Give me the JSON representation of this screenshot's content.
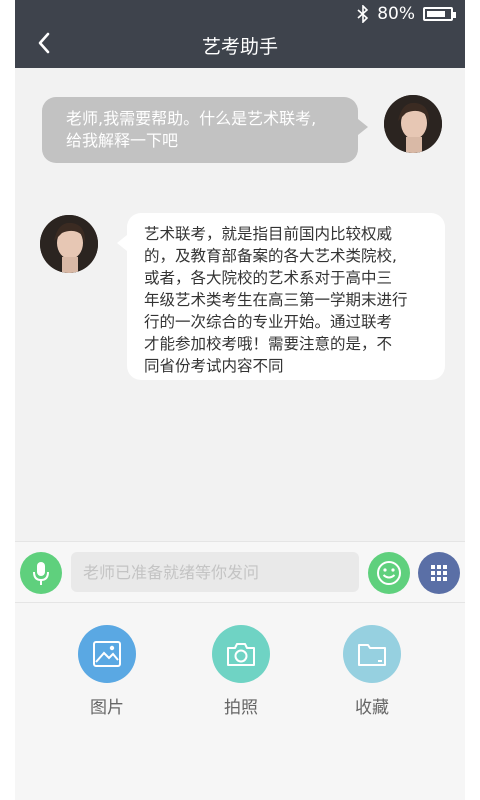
{
  "status_bar": {
    "battery_text": "80%",
    "battery_level": 0.8,
    "icons": [
      "bluetooth-icon",
      "battery-icon"
    ]
  },
  "header": {
    "title": "艺考助手",
    "back_icon": "back-arrow-icon"
  },
  "chat": {
    "messages": [
      {
        "sender": "user",
        "lines": [
          "老师,我需要帮助。什么是艺术联考,",
          "给我解释一下吧"
        ]
      },
      {
        "sender": "teacher",
        "lines": [
          "艺术联考，就是指目前国内比较权威",
          "的，及教育部备案的各大艺术类院校,",
          "或者，各大院校的艺术系对于高中三",
          "年级艺术类考生在高三第一学期末进行",
          "行的一次综合的专业开始。通过联考",
          "才能参加校考哦！需要注意的是，不",
          "同省份考试内容不同"
        ]
      }
    ]
  },
  "input_bar": {
    "placeholder": "老师已准备就绪等你发问",
    "value": ""
  },
  "tools": [
    {
      "label": "图片",
      "icon": "image-icon"
    },
    {
      "label": "拍照",
      "icon": "camera-icon"
    },
    {
      "label": "收藏",
      "icon": "folder-icon"
    }
  ],
  "colors": {
    "header_bg": "#3e434c",
    "user_bubble": "#c2c2c2",
    "bot_bubble": "#ffffff",
    "green": "#5fd07d",
    "blue": "#5a6fa6"
  }
}
